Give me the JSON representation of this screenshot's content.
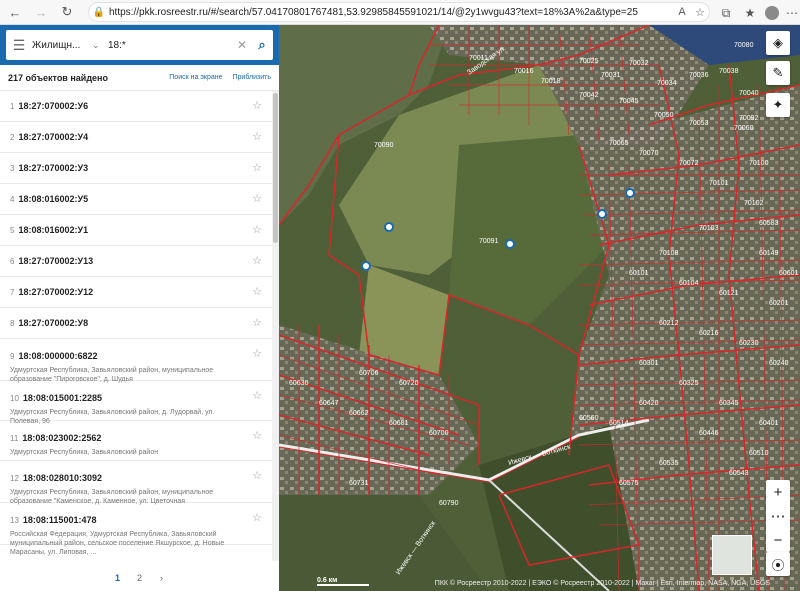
{
  "browser": {
    "url": "https://pkk.rosreestr.ru/#/search/57.04170801767481,53.92985845591021/14/@2y1wvgu43?text=18%3A%2a&type=25"
  },
  "search": {
    "filter_label": "Жилищн...",
    "query": "18:*"
  },
  "results": {
    "count_label": "217 объектов найдено",
    "link_on_screen": "Поиск на экране",
    "link_zoom": "Приблизить",
    "items": [
      {
        "idx": "1",
        "number": "18:27:070002:У6",
        "addr": ""
      },
      {
        "idx": "2",
        "number": "18:27:070002:У4",
        "addr": ""
      },
      {
        "idx": "3",
        "number": "18:27:070002:У3",
        "addr": ""
      },
      {
        "idx": "4",
        "number": "18:08:016002:У5",
        "addr": ""
      },
      {
        "idx": "5",
        "number": "18:08:016002:У1",
        "addr": ""
      },
      {
        "idx": "6",
        "number": "18:27:070002:У13",
        "addr": ""
      },
      {
        "idx": "7",
        "number": "18:27:070002:У12",
        "addr": ""
      },
      {
        "idx": "8",
        "number": "18:27:070002:У8",
        "addr": ""
      },
      {
        "idx": "9",
        "number": "18:08:000000:6822",
        "addr": "Удмуртская Республика, Завьяловский район, муниципальное образование \"Пироговское\", д. Шудья"
      },
      {
        "idx": "10",
        "number": "18:08:015001:2285",
        "addr": "Удмуртская Республика, Завьяловский район, д. Лудорвай, ул. Полевая, 96"
      },
      {
        "idx": "11",
        "number": "18:08:023002:2562",
        "addr": "Удмуртская Республика, Завьяловский район"
      },
      {
        "idx": "12",
        "number": "18:08:028010:3092",
        "addr": "Удмуртская Республика, Завьяловский район, муниципальное образование \"Каменское, д. Каменное, ул. Цветочная"
      },
      {
        "idx": "13",
        "number": "18:08:115001:478",
        "addr": "Российская Федерация, Удмуртская Республика, Завьяловский муниципальный район, сельское поселение Якшурское, д. Новые Марасаны, ул. Липовая, ..."
      }
    ]
  },
  "pager": {
    "page1": "1",
    "page2": "2",
    "next": "›"
  },
  "map": {
    "scale_label": "0.6 км",
    "attribution": "ПКК © Росреестр 2010-2022 | ЕЭКО © Росреестр 2010-2022 | Maxar | Esri, Intermap, NASA, NGA, USGS",
    "parcel_labels": [
      "70011",
      "70016",
      "70018",
      "70025",
      "70031",
      "70032",
      "70034",
      "70036",
      "70038",
      "70040",
      "70042",
      "70045",
      "70050",
      "70053",
      "70060",
      "70065",
      "70070",
      "70072",
      "70080",
      "70090",
      "70091",
      "70092",
      "70100",
      "70101",
      "70102",
      "70103",
      "70108",
      "60101",
      "60104",
      "60121",
      "60149",
      "60201",
      "60212",
      "60216",
      "60230",
      "60240",
      "60301",
      "60325",
      "60345",
      "60401",
      "60420",
      "60446",
      "60510",
      "60514",
      "60535",
      "60543",
      "60560",
      "60575",
      "60583",
      "60601",
      "60630",
      "60647",
      "60662",
      "60681",
      "60700",
      "60706",
      "60720",
      "60731",
      "60790"
    ]
  },
  "colors": {
    "brand": "#1a6ab0",
    "parcel_border": "#d8262a"
  }
}
